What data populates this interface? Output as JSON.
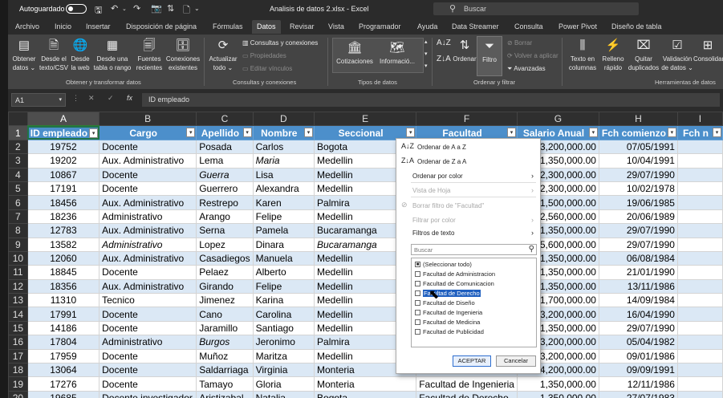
{
  "titlebar": {
    "autosave_label": "Autoguardado",
    "autosave_state": "off",
    "document_title": "Analisis de datos 2.xlsx  -  Excel",
    "search_placeholder": "Buscar"
  },
  "tabs": [
    "Archivo",
    "Inicio",
    "Insertar",
    "Disposición de página",
    "Fórmulas",
    "Datos",
    "Revisar",
    "Vista",
    "Programador",
    "Ayuda",
    "Data Streamer",
    "Consulta",
    "Power Pivot",
    "Diseño de tabla"
  ],
  "active_tab": "Datos",
  "ribbon": {
    "get_transform": {
      "btn_obtener": "Obtener",
      "btn_obtener_2": "datos ⌄",
      "btn_desde_texto": "Desde el",
      "btn_desde_texto_2": "texto/CSV",
      "btn_desde_web": "Desde",
      "btn_desde_web_2": "la web",
      "btn_desde_tabla": "Desde una",
      "btn_desde_tabla_2": "tabla o rango",
      "btn_fuentes": "Fuentes",
      "btn_fuentes_2": "recientes",
      "btn_conexiones": "Conexiones",
      "btn_conexiones_2": "existentes",
      "label": "Obtener y transformar datos"
    },
    "queries": {
      "btn_actualizar": "Actualizar",
      "btn_actualizar_2": "todo ⌄",
      "consultas": "Consultas y conexiones",
      "propiedades": "Propiedades",
      "editar": "Editar vínculos",
      "label": "Consultas y conexiones"
    },
    "datatypes": {
      "cotizaciones": "Cotizaciones",
      "informacion": "Informació...",
      "label": "Tipos de datos"
    },
    "sort": {
      "ordenar": "Ordenar",
      "filtro": "Filtro",
      "borrar": "Borrar",
      "volver": "Volver a aplicar",
      "avanzadas": "Avanzadas",
      "label": "Ordenar y filtrar"
    },
    "tools": {
      "texto": "Texto en",
      "texto_2": "columnas",
      "relleno": "Relleno",
      "relleno_2": "rápido",
      "quitar": "Quitar",
      "quitar_2": "duplicados",
      "validacion": "Validación",
      "validacion_2": "de datos ⌄",
      "consolidar": "Consolidar",
      "label": "Herramientas de datos"
    }
  },
  "formula_bar": {
    "name_box": "A1",
    "cancel": "✕",
    "enter": "✓",
    "fx": "fx",
    "content": "ID empleado"
  },
  "columns": [
    "A",
    "B",
    "C",
    "D",
    "E",
    "F",
    "G",
    "H",
    "I"
  ],
  "row_numbers": [
    "1",
    "2",
    "3",
    "4",
    "5",
    "6",
    "7",
    "8",
    "9",
    "10",
    "11",
    "12",
    "13",
    "14",
    "15",
    "16",
    "17",
    "18",
    "19",
    "20"
  ],
  "headers": [
    "ID empleado",
    "Cargo",
    "Apellido",
    "Nombre",
    "Seccional",
    "Facultad",
    "Salario Anual",
    "Fch comienzo",
    "Fch n"
  ],
  "rows": [
    [
      "19752",
      "Docente",
      "Posada",
      "Carlos",
      "Bogota",
      "",
      "3,200,000.00",
      "07/05/1991",
      ""
    ],
    [
      "19202",
      "Aux. Administrativo",
      "Lema",
      "Maria",
      "Medellin",
      "",
      "1,350,000.00",
      "10/04/1991",
      ""
    ],
    [
      "10867",
      "Docente",
      "Guerra",
      "Lisa",
      "Medellin",
      "",
      "2,300,000.00",
      "29/07/1990",
      ""
    ],
    [
      "17191",
      "Docente",
      "Guerrero",
      "Alexandra",
      "Medellin",
      "",
      "2,300,000.00",
      "10/02/1978",
      ""
    ],
    [
      "18456",
      "Aux. Administrativo",
      "Restrepo",
      "Karen",
      "Palmira",
      "",
      "1,500,000.00",
      "19/06/1985",
      ""
    ],
    [
      "18236",
      "Administrativo",
      "Arango",
      "Felipe",
      "Medellin",
      "",
      "2,560,000.00",
      "20/06/1989",
      ""
    ],
    [
      "12783",
      "Aux. Administrativo",
      "Serna",
      "Pamela",
      "Bucaramanga",
      "",
      "1,350,000.00",
      "29/07/1990",
      ""
    ],
    [
      "13582",
      "Administrativo",
      "Lopez",
      "Dinara",
      "Bucaramanga",
      "",
      "5,600,000.00",
      "29/07/1990",
      ""
    ],
    [
      "12060",
      "Aux. Administrativo",
      "Casadiegos",
      "Manuela",
      "Medellin",
      "",
      "1,350,000.00",
      "06/08/1984",
      ""
    ],
    [
      "18845",
      "Docente",
      "Pelaez",
      "Alberto",
      "Medellin",
      "",
      "1,350,000.00",
      "21/01/1990",
      ""
    ],
    [
      "18356",
      "Aux. Administrativo",
      "Girando",
      "Felipe",
      "Medellin",
      "",
      "1,350,000.00",
      "13/11/1986",
      ""
    ],
    [
      "11310",
      "Tecnico",
      "Jimenez",
      "Karina",
      "Medellin",
      "",
      "1,700,000.00",
      "14/09/1984",
      ""
    ],
    [
      "17991",
      "Docente",
      "Cano",
      "Carolina",
      "Medellin",
      "",
      "3,200,000.00",
      "16/04/1990",
      ""
    ],
    [
      "14186",
      "Docente",
      "Jaramillo",
      "Santiago",
      "Medellin",
      "",
      "1,350,000.00",
      "29/07/1990",
      ""
    ],
    [
      "17804",
      "Administrativo",
      "Burgos",
      "Jeronimo",
      "Palmira",
      "",
      "3,200,000.00",
      "05/04/1982",
      ""
    ],
    [
      "17959",
      "Docente",
      "Muñoz",
      "Maritza",
      "Medellin",
      "",
      "3,200,000.00",
      "09/01/1986",
      ""
    ],
    [
      "13064",
      "Docente",
      "Saldarriaga",
      "Virginia",
      "Monteria",
      "",
      "4,200,000.00",
      "09/09/1991",
      ""
    ],
    [
      "17276",
      "Docente",
      "Tamayo",
      "Gloria",
      "Monteria",
      "Facultad de Ingenieria",
      "1,350,000.00",
      "12/11/1986",
      ""
    ],
    [
      "19685",
      "Docente investigador",
      "Aristizabal",
      "Natalia",
      "Bogota",
      "Facultad de Derecho",
      "1,350,000.00",
      "27/07/1983",
      ""
    ]
  ],
  "filter_menu": {
    "sort_az": "Ordenar de A a Z",
    "sort_za": "Ordenar de Z a A",
    "sort_color": "Ordenar por color",
    "sheet_view": "Vista de Hoja",
    "clear_filter": "Borrar filtro de \"Facultad\"",
    "filter_color": "Filtrar por color",
    "text_filters": "Filtros de texto",
    "search_placeholder": "Buscar",
    "items": [
      {
        "label": "(Seleccionar todo)",
        "state": "partial"
      },
      {
        "label": "Facultad de Administracion",
        "state": "unchecked"
      },
      {
        "label": "Facultad de Comunicacion",
        "state": "unchecked"
      },
      {
        "label": "Facultad de Derecho",
        "state": "checked"
      },
      {
        "label": "Facultad de Diseño",
        "state": "unchecked"
      },
      {
        "label": "Facultad de Ingenieria",
        "state": "unchecked"
      },
      {
        "label": "Facultad de Medicina",
        "state": "unchecked"
      },
      {
        "label": "Facultad de Publicidad",
        "state": "unchecked"
      }
    ],
    "accept": "ACEPTAR",
    "cancel": "Cancelar"
  },
  "colors": {
    "table_header": "#4c8fcb",
    "band_row": "#dbe8f5",
    "ribbon_bg": "#444444",
    "titlebar_bg": "#2b2b2b",
    "highlight": "#1f5fbf"
  }
}
